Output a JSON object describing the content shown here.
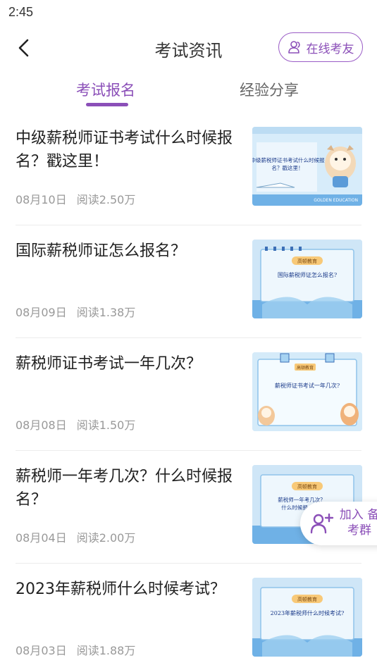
{
  "status_bar": {
    "time": "2:45"
  },
  "header": {
    "title": "考试资讯",
    "online_button": "在线考友"
  },
  "tabs": [
    {
      "label": "考试报名",
      "active": true
    },
    {
      "label": "经验分享",
      "active": false
    }
  ],
  "articles": [
    {
      "title": "中级薪税师证书考试什么时候报名？戳这里！",
      "date": "08月10日",
      "reads": "阅读2.50万",
      "thumb_text": "中级薪税师证书考试什么时候报名？戳这里！",
      "thumb_footer": "GOLDEN EDUCATION"
    },
    {
      "title": "国际薪税师证怎么报名？",
      "date": "08月09日",
      "reads": "阅读1.38万",
      "thumb_badge": "高顿教育",
      "thumb_text": "国际薪税师证怎么报名?"
    },
    {
      "title": "薪税师证书考试一年几次？",
      "date": "08月08日",
      "reads": "阅读1.50万",
      "thumb_badge": "高顿教育",
      "thumb_text": "薪税师证书考试一年几次?"
    },
    {
      "title": "薪税师一年考几次？什么时候报名？",
      "date": "08月04日",
      "reads": "阅读2.00万",
      "thumb_badge": "高顿教育",
      "thumb_text": "薪税师一年考几次？什么时候报"
    },
    {
      "title": "2023年薪税师什么时候考试？",
      "date": "08月03日",
      "reads": "阅读1.88万",
      "thumb_badge": "高顿教育",
      "thumb_text": "2023年薪税师什么时候考试?"
    }
  ],
  "floating": {
    "join_line1": "加入 备",
    "join_line2": "考群"
  },
  "colors": {
    "accent": "#8b4fb8",
    "thumb_bg": "#cfe6f7",
    "thumb_dark": "#4a90d6"
  }
}
